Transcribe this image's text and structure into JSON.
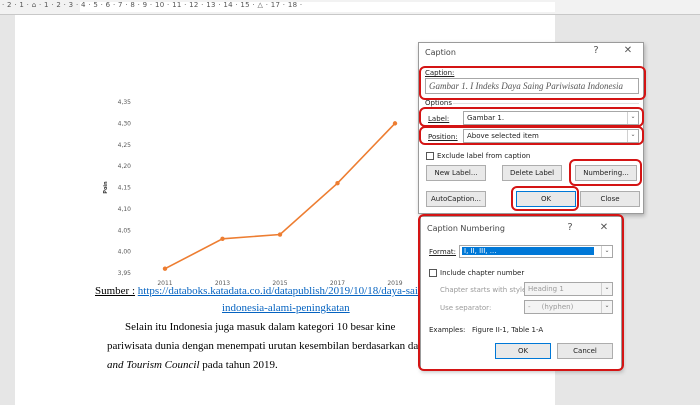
{
  "ruler": {
    "numbers": "· 2 · 1 · ⌂ · 1 · 2 · 3 · 4 · 5 · 6 · 7 · 8 · 9 · 10 · 11 · 12 · 13 · 14 · 15 · △ · 17 · 18 ·"
  },
  "chart_data": {
    "type": "line",
    "x": [
      "2011",
      "2013",
      "2015",
      "2017",
      "2019"
    ],
    "series": [
      {
        "values": [
          3.96,
          4.03,
          4.04,
          4.16,
          4.3
        ]
      }
    ],
    "ylabel": "Poin",
    "ylim": [
      3.95,
      4.35
    ],
    "yticks": [
      "3,95",
      "4,00",
      "4,05",
      "4,10",
      "4,15",
      "4,20",
      "4,25",
      "4,30",
      "4,35"
    ],
    "color": "#ed7d31",
    "grid": false
  },
  "doc": {
    "source_prefix": "Sumber :",
    "source_link_1": "https://databoks.katadata.co.id/datapublish/2019/10/18/daya-saing",
    "source_link_2": "indonesia-alami-peningkatan",
    "para_line1_a": "Selain itu Indonesia juga masuk dalam kategori 10 besar kine",
    "para_line2": "pariwisata dunia dengan menempati urutan kesembilan berdasarkan dat",
    "para_line3_italic": "and Tourism Council",
    "para_line3_rest": " pada tahun 2019."
  },
  "caption_dialog": {
    "title": "Caption",
    "help": "?",
    "close": "✕",
    "caption_label": "Caption:",
    "caption_value": "Gambar 1. I Indeks Daya Saing Pariwisata Indonesia",
    "options_label": "Options",
    "label_label": "Label:",
    "label_value": "Gambar 1.",
    "position_label": "Position:",
    "position_value": "Above selected item",
    "exclude_label": "Exclude label from caption",
    "new_label_btn": "New Label...",
    "delete_label_btn": "Delete Label",
    "numbering_btn": "Numbering...",
    "autocaption_btn": "AutoCaption...",
    "ok_btn": "OK",
    "close_btn": "Close"
  },
  "numbering_dialog": {
    "title": "Caption Numbering",
    "help": "?",
    "close": "✕",
    "format_label": "Format:",
    "format_value": "I, II, III, ...",
    "include_chapter": "Include chapter number",
    "chapter_starts_label": "Chapter starts with style",
    "chapter_starts_value": "Heading 1",
    "separator_label": "Use separator:",
    "separator_value": "-     (hyphen)",
    "examples": "Examples:   Figure II-1, Table 1-A",
    "ok_btn": "OK",
    "cancel_btn": "Cancel"
  }
}
